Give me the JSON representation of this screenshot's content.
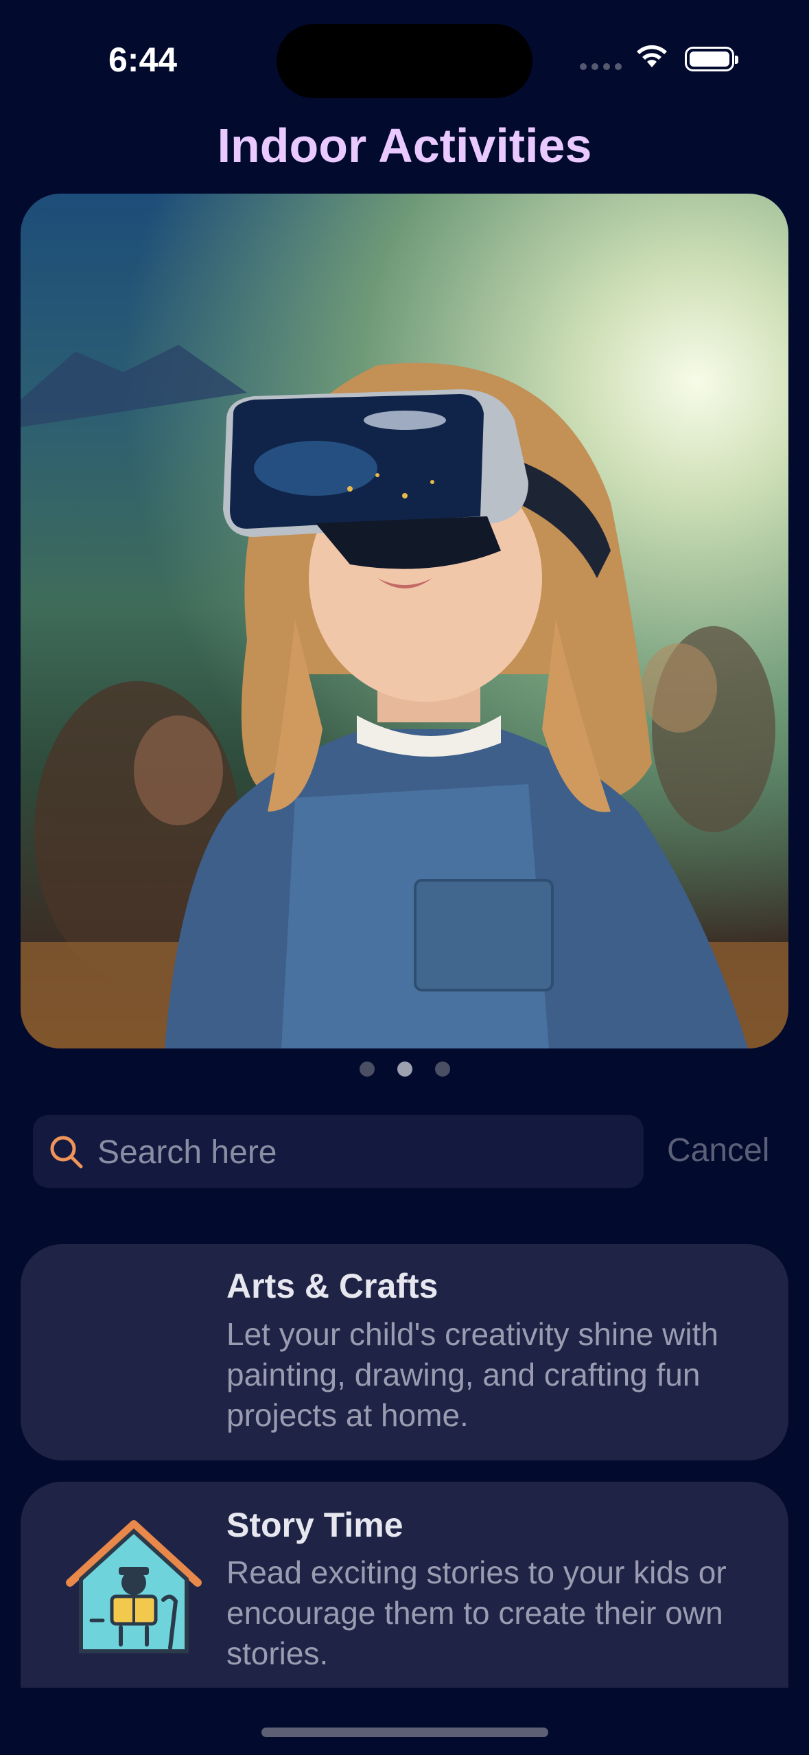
{
  "status_bar": {
    "time": "6:44"
  },
  "header": {
    "title": "Indoor Activities"
  },
  "carousel": {
    "page_count": 3,
    "active_index": 1
  },
  "search": {
    "placeholder": "Search here",
    "value": "",
    "cancel_label": "Cancel"
  },
  "activities": [
    {
      "title": "Arts & Crafts",
      "description": "Let your child's creativity shine with painting, drawing, and crafting fun projects at home."
    },
    {
      "title": "Story Time",
      "description": "Read exciting stories to your kids or encourage them to create their own stories."
    }
  ],
  "colors": {
    "background": "#020a2e",
    "title": "#e9c9ff",
    "card": "#1f2345",
    "search_accent": "#f0945a"
  }
}
